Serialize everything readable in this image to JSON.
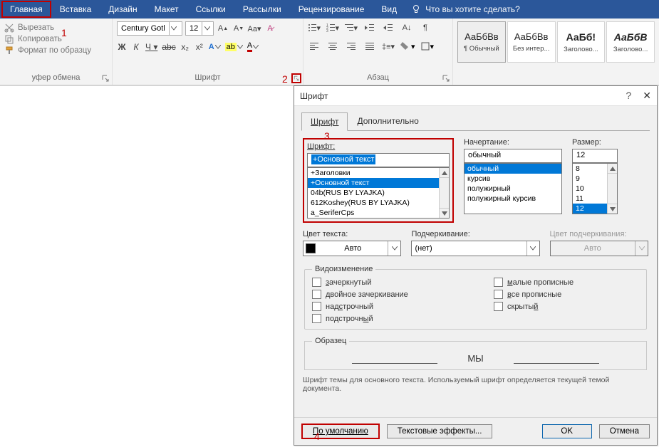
{
  "menubar": {
    "tabs": [
      "Главная",
      "Вставка",
      "Дизайн",
      "Макет",
      "Ссылки",
      "Рассылки",
      "Рецензирование",
      "Вид"
    ],
    "tellme": "Что вы хотите сделать?"
  },
  "ribbon": {
    "clipboard": {
      "cut": "Вырезать",
      "copy": "Копировать",
      "format_painter": "Формат по образцу",
      "label": "уфер обмена"
    },
    "font": {
      "name": "Century Gotl",
      "size": "12",
      "label": "Шрифт"
    },
    "paragraph": {
      "label": "Абзац"
    },
    "styles": {
      "sample": "АаБбВв",
      "sample_h1": "АаБб!",
      "sample_h2": "АаБбВ",
      "items": [
        "¶ Обычный",
        "Без интер...",
        "Заголово...",
        "Заголово..."
      ]
    }
  },
  "callouts": {
    "c1": "1",
    "c2": "2",
    "c3": "3",
    "c4": "4"
  },
  "dialog": {
    "title": "Шрифт",
    "tabs": [
      "Шрифт",
      "Дополнительно"
    ],
    "font": {
      "label": "Шрифт:",
      "value": "+Основной текст",
      "list": [
        "+Заголовки",
        "+Основной текст",
        "04b(RUS BY LYAJKA)",
        "612Koshey(RUS BY LYAJKA)",
        "a_SeriferCps"
      ]
    },
    "style": {
      "label": "Начертание:",
      "value": "обычный",
      "list": [
        "обычный",
        "курсив",
        "полужирный",
        "полужирный курсив"
      ]
    },
    "size": {
      "label": "Размер:",
      "value": "12",
      "list": [
        "8",
        "9",
        "10",
        "11",
        "12"
      ]
    },
    "color": {
      "label": "Цвет текста:",
      "value": "Авто"
    },
    "under_style": {
      "label": "Подчеркивание:",
      "value": "(нет)"
    },
    "under_color": {
      "label": "Цвет подчеркивания:",
      "value": "Авто"
    },
    "effects": {
      "legend": "Видоизменение",
      "strike": "зачеркнутый",
      "dbl_strike": "двойное зачеркивание",
      "super": "надстрочный",
      "sub": "подстрочный",
      "smallcaps": "малые прописные",
      "allcaps": "все прописные",
      "hidden": "скрытый"
    },
    "sample": {
      "legend": "Образец",
      "text": "МЫ"
    },
    "description": "Шрифт темы для основного текста. Используемый шрифт определяется текущей темой документа.",
    "buttons": {
      "default": "По умолчанию",
      "text_effects": "Текстовые эффекты...",
      "ok": "OK",
      "cancel": "Отмена"
    }
  }
}
